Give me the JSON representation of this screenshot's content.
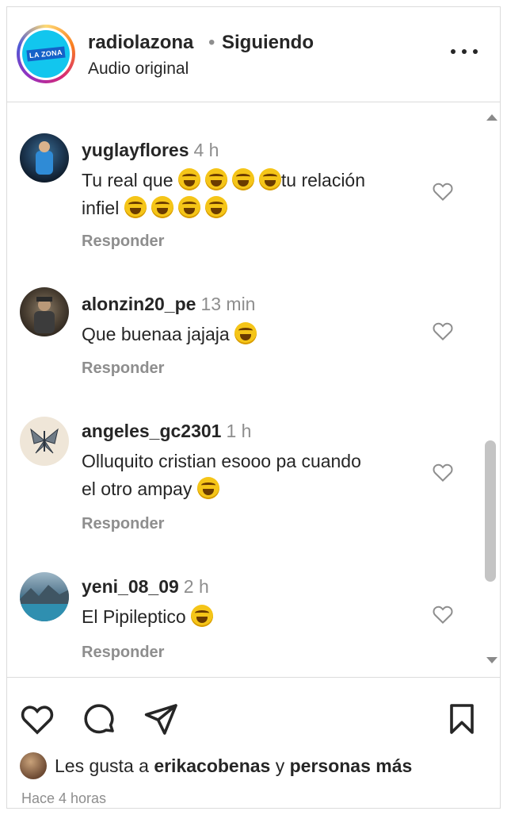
{
  "header": {
    "account_name": "radiolazona",
    "separator": "•",
    "follow_state": "Siguiendo",
    "audio_label": "Audio original",
    "logo_text": "LA ZONA"
  },
  "comments": [
    {
      "username": "yuglayflores",
      "time": "4 h",
      "text_a": "Tu real que",
      "text_b": "tu relación",
      "text_c": "infiel",
      "reply": "Responder"
    },
    {
      "username": "alonzin20_pe",
      "time": "13 min",
      "text_a": "Que buenaa jajaja",
      "reply": "Responder"
    },
    {
      "username": "angeles_gc2301",
      "time": "1 h",
      "text_a": "Olluquito cristian esooo pa cuando",
      "text_b": "el otro ampay",
      "reply": "Responder"
    },
    {
      "username": "yeni_08_09",
      "time": "2 h",
      "text_a": "El Pipileptico",
      "reply": "Responder"
    }
  ],
  "footer": {
    "likes_prefix": "Les gusta a",
    "likes_user": "erikacobenas",
    "likes_mid": "y",
    "likes_suffix": "personas más",
    "timestamp": "Hace 4 horas"
  },
  "icons": {
    "like": "heart-icon",
    "comment": "speech-bubble-icon",
    "share": "paper-plane-icon",
    "save": "bookmark-icon",
    "more": "ellipsis-icon",
    "emoji": "face-with-tears-of-joy"
  },
  "colors": {
    "text": "#262626",
    "secondary": "#8e8e8e",
    "border": "#dbdbdb",
    "logo_bg": "#12c6ee"
  }
}
